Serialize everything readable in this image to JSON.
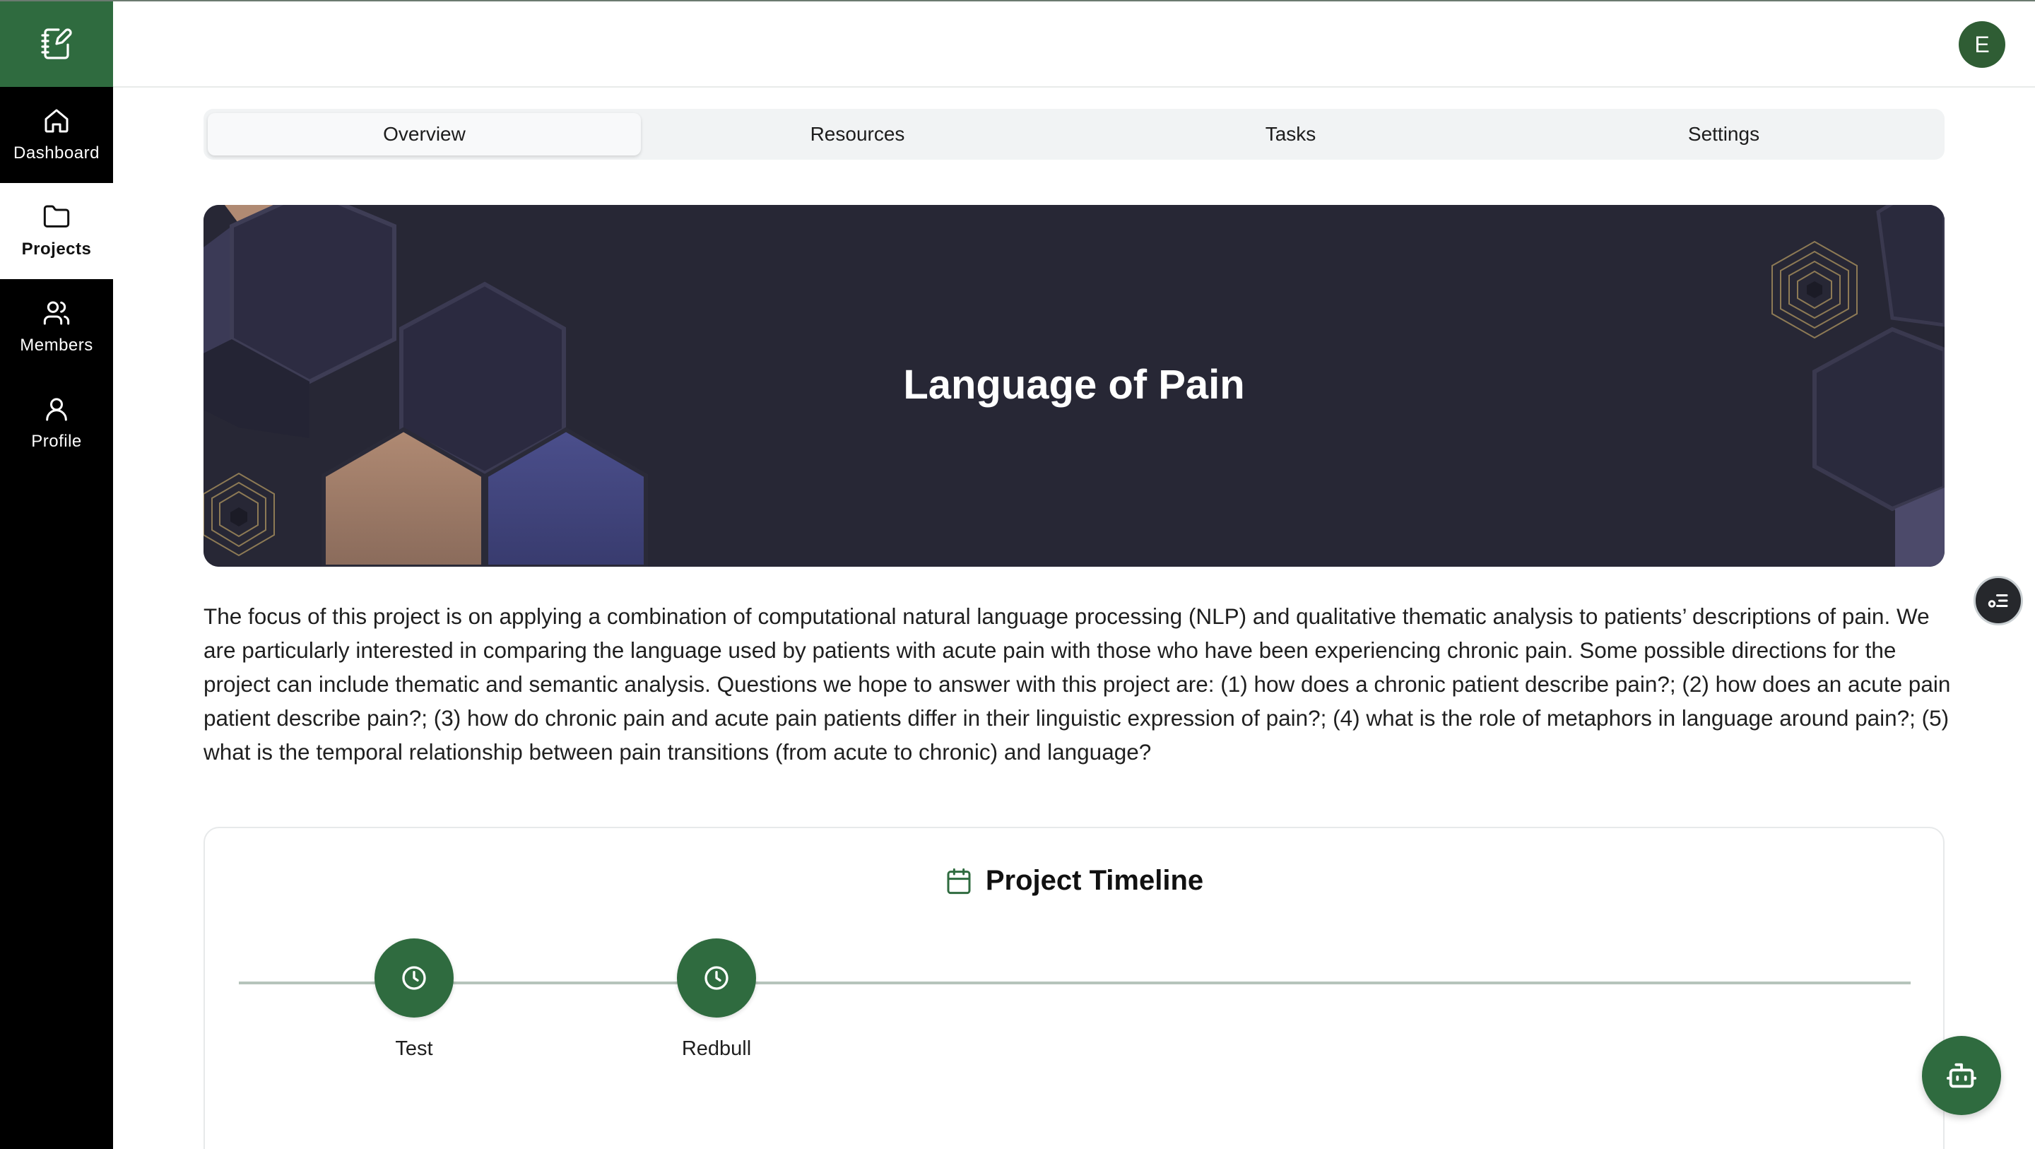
{
  "nav": {
    "items": [
      {
        "label": "Dashboard",
        "icon": "home-icon"
      },
      {
        "label": "Projects",
        "icon": "folder-icon",
        "active": true
      },
      {
        "label": "Members",
        "icon": "users-icon"
      },
      {
        "label": "Profile",
        "icon": "user-icon"
      }
    ]
  },
  "header": {
    "avatar_initial": "E"
  },
  "tabs": [
    {
      "label": "Overview",
      "active": true
    },
    {
      "label": "Resources"
    },
    {
      "label": "Tasks"
    },
    {
      "label": "Settings"
    }
  ],
  "project": {
    "title": "Language of Pain",
    "description": "The focus of this project is on applying a combination of computational natural language processing (NLP) and qualitative thematic analysis to patients’ descriptions of pain. We are particularly interested in comparing the language used by patients with acute pain with those who have been experiencing chronic pain. Some possible directions for the project can include thematic and semantic analysis. Questions we hope to answer with this project are: (1) how does a chronic patient describe pain?; (2) how does an acute pain patient describe pain?; (3) how do chronic pain and acute pain patients differ in their linguistic expression of pain?; (4) what is the role of metaphors in language around pain?; (5) what is the temporal relationship between pain transitions (from acute to chronic) and language?"
  },
  "timeline": {
    "title": "Project Timeline",
    "milestones": [
      {
        "label": "Test"
      },
      {
        "label": "Redbull"
      }
    ]
  },
  "colors": {
    "brand_green": "#2f6b3f",
    "sidebar_bg": "#000000",
    "banner_bg": "#272735"
  }
}
